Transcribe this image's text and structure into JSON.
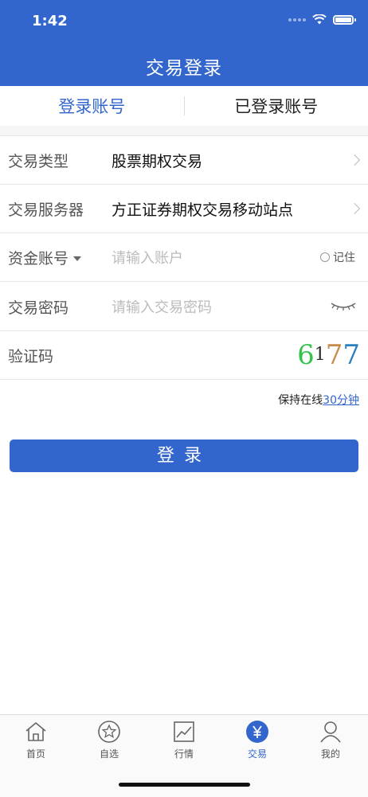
{
  "status": {
    "time": "1:42"
  },
  "header": {
    "title": "交易登录"
  },
  "tabs": [
    {
      "label": "登录账号",
      "active": true
    },
    {
      "label": "已登录账号",
      "active": false
    }
  ],
  "form": {
    "trade_type_label": "交易类型",
    "trade_type_value": "股票期权交易",
    "server_label": "交易服务器",
    "server_value": "方正证券期权交易移动站点",
    "account_label": "资金账号",
    "account_placeholder": "请输入账户",
    "remember_label": "记住",
    "password_label": "交易密码",
    "password_placeholder": "请输入交易密码",
    "captcha_label": "验证码",
    "captcha_digits": [
      "6",
      "1",
      "7",
      "7"
    ]
  },
  "keep_online": {
    "prefix": "保持在线",
    "duration": "30分钟"
  },
  "login_button": "登录",
  "tabbar": [
    {
      "label": "首页",
      "icon": "home-icon"
    },
    {
      "label": "自选",
      "icon": "star-icon"
    },
    {
      "label": "行情",
      "icon": "chart-icon"
    },
    {
      "label": "交易",
      "icon": "yen-icon",
      "active": true
    },
    {
      "label": "我的",
      "icon": "user-icon"
    }
  ],
  "colors": {
    "primary": "#3366cc"
  }
}
